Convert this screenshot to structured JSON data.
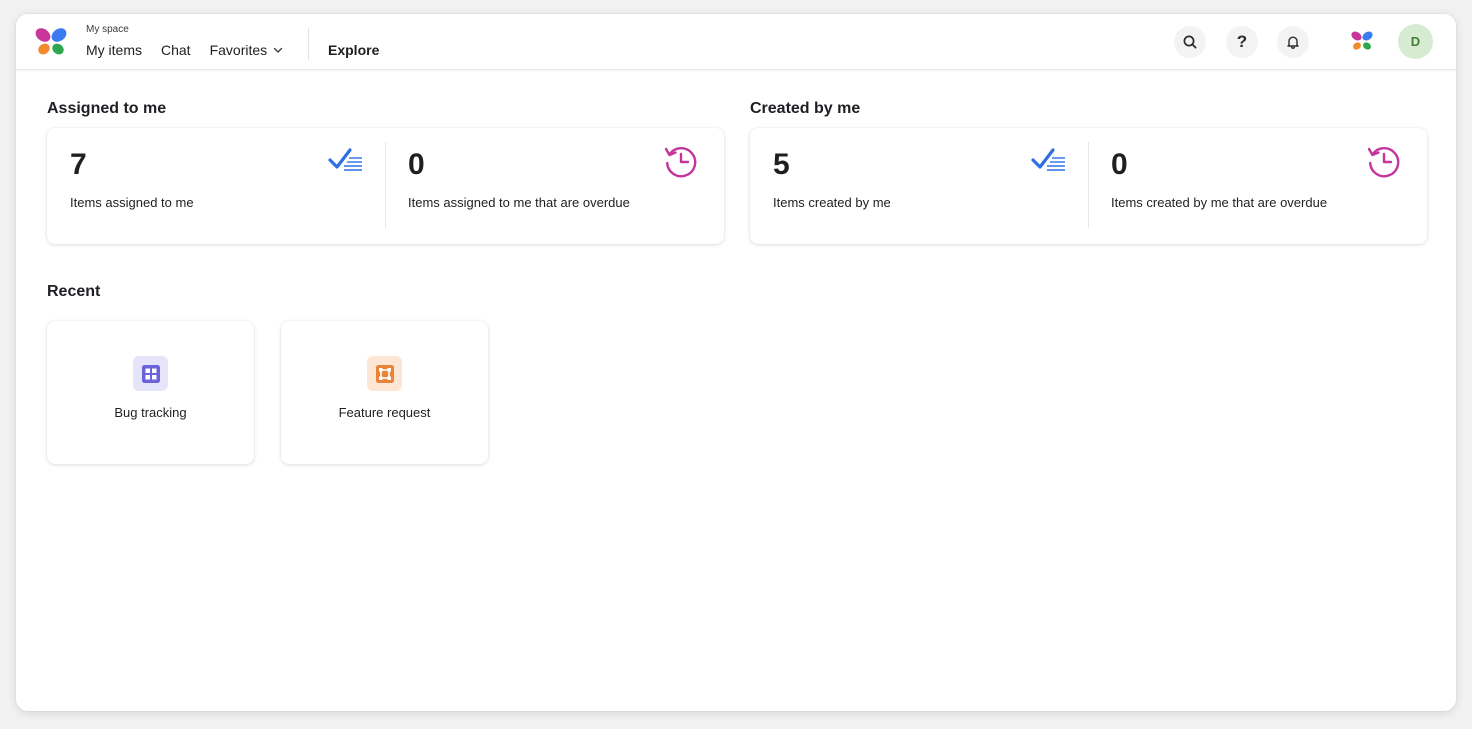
{
  "header": {
    "space_label": "My space",
    "nav": [
      {
        "label": "My items"
      },
      {
        "label": "Chat"
      },
      {
        "label": "Favorites"
      }
    ],
    "explore_label": "Explore",
    "avatar_initial": "D",
    "icons": [
      "logo-butterfly-icon",
      "search-icon",
      "help-icon",
      "bell-icon",
      "brand-butterfly-icon"
    ]
  },
  "assigned": {
    "title": "Assigned to me",
    "total": {
      "value": "7",
      "label": "Items assigned to me",
      "icon": "checklist-icon"
    },
    "overdue": {
      "value": "0",
      "label": "Items assigned to me that are overdue",
      "icon": "history-clock-icon"
    }
  },
  "created": {
    "title": "Created by me",
    "total": {
      "value": "5",
      "label": "Items created by me",
      "icon": "checklist-icon"
    },
    "overdue": {
      "value": "0",
      "label": "Items created by me that are overdue",
      "icon": "history-clock-icon"
    }
  },
  "recent": {
    "title": "Recent",
    "items": [
      {
        "label": "Bug tracking",
        "icon": "grid-board-icon",
        "color": "#6b63d9",
        "bg": "#e6e4fb"
      },
      {
        "label": "Feature request",
        "icon": "frame-board-icon",
        "color": "#e8843a",
        "bg": "#fde6d3"
      }
    ]
  },
  "colors": {
    "accent_blue": "#2f6fe4",
    "overdue_magenta": "#c4359c",
    "avatar_bg": "#d7ebd3"
  }
}
